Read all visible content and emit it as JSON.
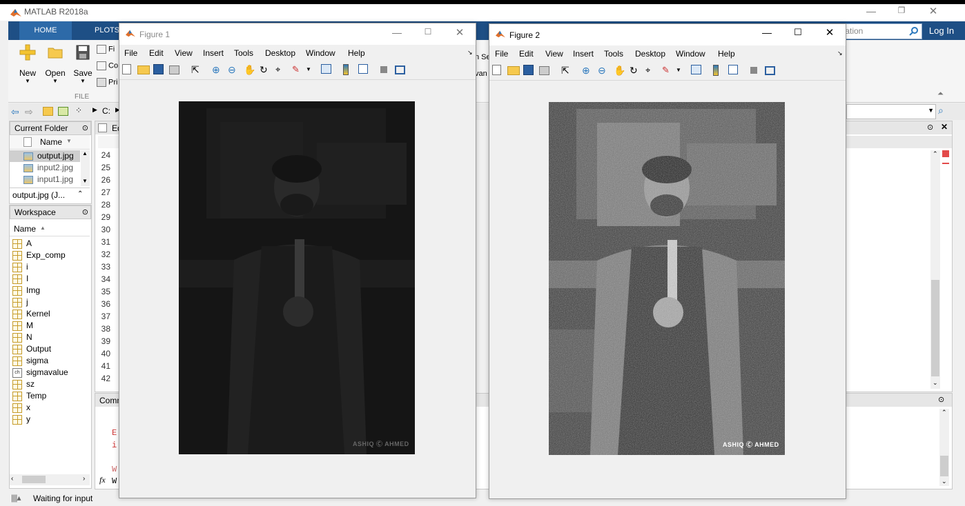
{
  "app": {
    "title": "MATLAB R2018a",
    "window_controls": [
      "—",
      "❐",
      "✕"
    ]
  },
  "ribbon": {
    "tabs": [
      "HOME",
      "PLOTS"
    ],
    "search_placeholder": "tation",
    "login_label": "Log In",
    "buttons": [
      "New",
      "Open",
      "Save"
    ],
    "small_items": [
      "Fi",
      "Co",
      "Pri"
    ],
    "section_label": "FILE",
    "behind_text": [
      "n Se",
      "van"
    ]
  },
  "address": {
    "path": "C:"
  },
  "current_folder": {
    "title": "Current Folder",
    "column_name": "Name",
    "files": [
      "output.jpg",
      "input2.jpg",
      "input1.jpg"
    ],
    "detail": "output.jpg  (J..."
  },
  "workspace": {
    "title": "Workspace",
    "column_name": "Name",
    "variables": [
      {
        "name": "A",
        "type": "matrix"
      },
      {
        "name": "Exp_comp",
        "type": "matrix"
      },
      {
        "name": "i",
        "type": "matrix"
      },
      {
        "name": "I",
        "type": "matrix"
      },
      {
        "name": "Img",
        "type": "matrix"
      },
      {
        "name": "j",
        "type": "matrix"
      },
      {
        "name": "Kernel",
        "type": "matrix"
      },
      {
        "name": "M",
        "type": "matrix"
      },
      {
        "name": "N",
        "type": "matrix"
      },
      {
        "name": "Output",
        "type": "matrix"
      },
      {
        "name": "sigma",
        "type": "matrix"
      },
      {
        "name": "sigmavalue",
        "type": "char"
      },
      {
        "name": "sz",
        "type": "matrix"
      },
      {
        "name": "Temp",
        "type": "matrix"
      },
      {
        "name": "x",
        "type": "matrix"
      },
      {
        "name": "y",
        "type": "matrix"
      }
    ]
  },
  "editor": {
    "tab_label": "Ed",
    "line_numbers": [
      "24",
      "25",
      "26",
      "27",
      "28",
      "29",
      "30",
      "31",
      "32",
      "33",
      "34",
      "35",
      "36",
      "37",
      "38",
      "39",
      "40",
      "41",
      "42"
    ]
  },
  "command_window": {
    "title": "Comm",
    "lines": [
      "E",
      "i",
      "W"
    ],
    "prompt_symbol": "fx",
    "prompt_text": "W"
  },
  "status": {
    "text": "Waiting for input"
  },
  "figures": [
    {
      "title": "Figure 1",
      "menus": [
        "File",
        "Edit",
        "View",
        "Insert",
        "Tools",
        "Desktop",
        "Window",
        "Help"
      ],
      "watermark": "ASHIQ Ⓒ AHMED",
      "image_desc": "dark"
    },
    {
      "title": "Figure 2",
      "menus": [
        "File",
        "Edit",
        "View",
        "Insert",
        "Tools",
        "Desktop",
        "Window",
        "Help"
      ],
      "watermark": "ASHIQ Ⓒ AHMED",
      "image_desc": "noisy"
    }
  ],
  "colors": {
    "tabstrip": "#1e4f85",
    "hometab": "#2d6aa8",
    "figure_bg": "#f0f0f0"
  }
}
